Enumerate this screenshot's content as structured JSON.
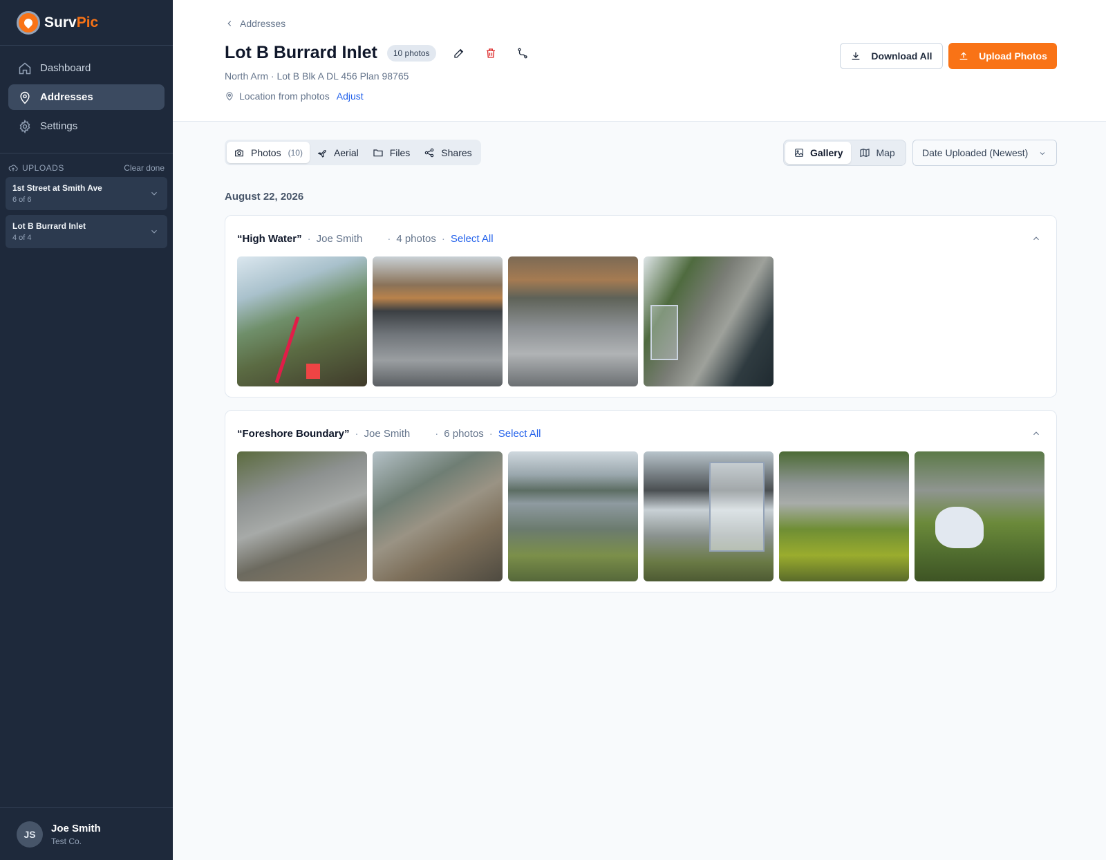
{
  "brand": {
    "name_part1": "Surv",
    "name_part2": "Pic",
    "accent": "#f97316"
  },
  "nav": [
    {
      "label": "Dashboard",
      "icon": "home-icon",
      "active": false
    },
    {
      "label": "Addresses",
      "icon": "map-pin-icon",
      "active": true
    },
    {
      "label": "Settings",
      "icon": "gear-icon",
      "active": false
    }
  ],
  "uploads": {
    "title": "UPLOADS",
    "clear_label": "Clear done",
    "items": [
      {
        "name": "1st Street at Smith Ave",
        "count": "6 of 6"
      },
      {
        "name": "Lot B Burrard Inlet",
        "count": "4 of 4"
      }
    ]
  },
  "user": {
    "initials": "JS",
    "name": "Joe Smith",
    "company": "Test Co."
  },
  "header": {
    "breadcrumb": "Addresses",
    "title": "Lot B Burrard Inlet",
    "photo_badge": "10 photos",
    "subline": "North Arm · Lot B Blk A DL 456 Plan 98765",
    "location_text": "Location from photos",
    "adjust_label": "Adjust",
    "download_label": "Download All",
    "upload_label": "Upload Photos"
  },
  "tabs": [
    {
      "label": "Photos",
      "count": "(10)",
      "icon": "camera-icon",
      "active": true
    },
    {
      "label": "Aerial",
      "count": "",
      "icon": "plane-icon",
      "active": false
    },
    {
      "label": "Files",
      "count": "",
      "icon": "folder-icon",
      "active": false
    },
    {
      "label": "Shares",
      "count": "",
      "icon": "share-icon",
      "active": false
    }
  ],
  "view": {
    "gallery_label": "Gallery",
    "map_label": "Map",
    "active": "gallery"
  },
  "sort": {
    "selected": "Date Uploaded (Newest)"
  },
  "date_label": "August 22, 2026",
  "groups": [
    {
      "name": "“High Water”",
      "author": "Joe Smith",
      "count_label": "4 photos",
      "select_label": "Select All",
      "photos": [
        {
          "icon": "photo-forest-shore"
        },
        {
          "icon": "photo-deck-rocks"
        },
        {
          "icon": "photo-rock-stairs"
        },
        {
          "icon": "photo-rocky-water"
        }
      ]
    },
    {
      "name": "“Foreshore Boundary”",
      "author": "Joe Smith",
      "count_label": "6 photos",
      "select_label": "Select All",
      "photos": [
        {
          "icon": "photo-rock-debris"
        },
        {
          "icon": "photo-shore-logs"
        },
        {
          "icon": "photo-lake-view"
        },
        {
          "icon": "photo-greenhouse"
        },
        {
          "icon": "photo-garden-rocks"
        },
        {
          "icon": "photo-garden-bags"
        }
      ]
    }
  ]
}
